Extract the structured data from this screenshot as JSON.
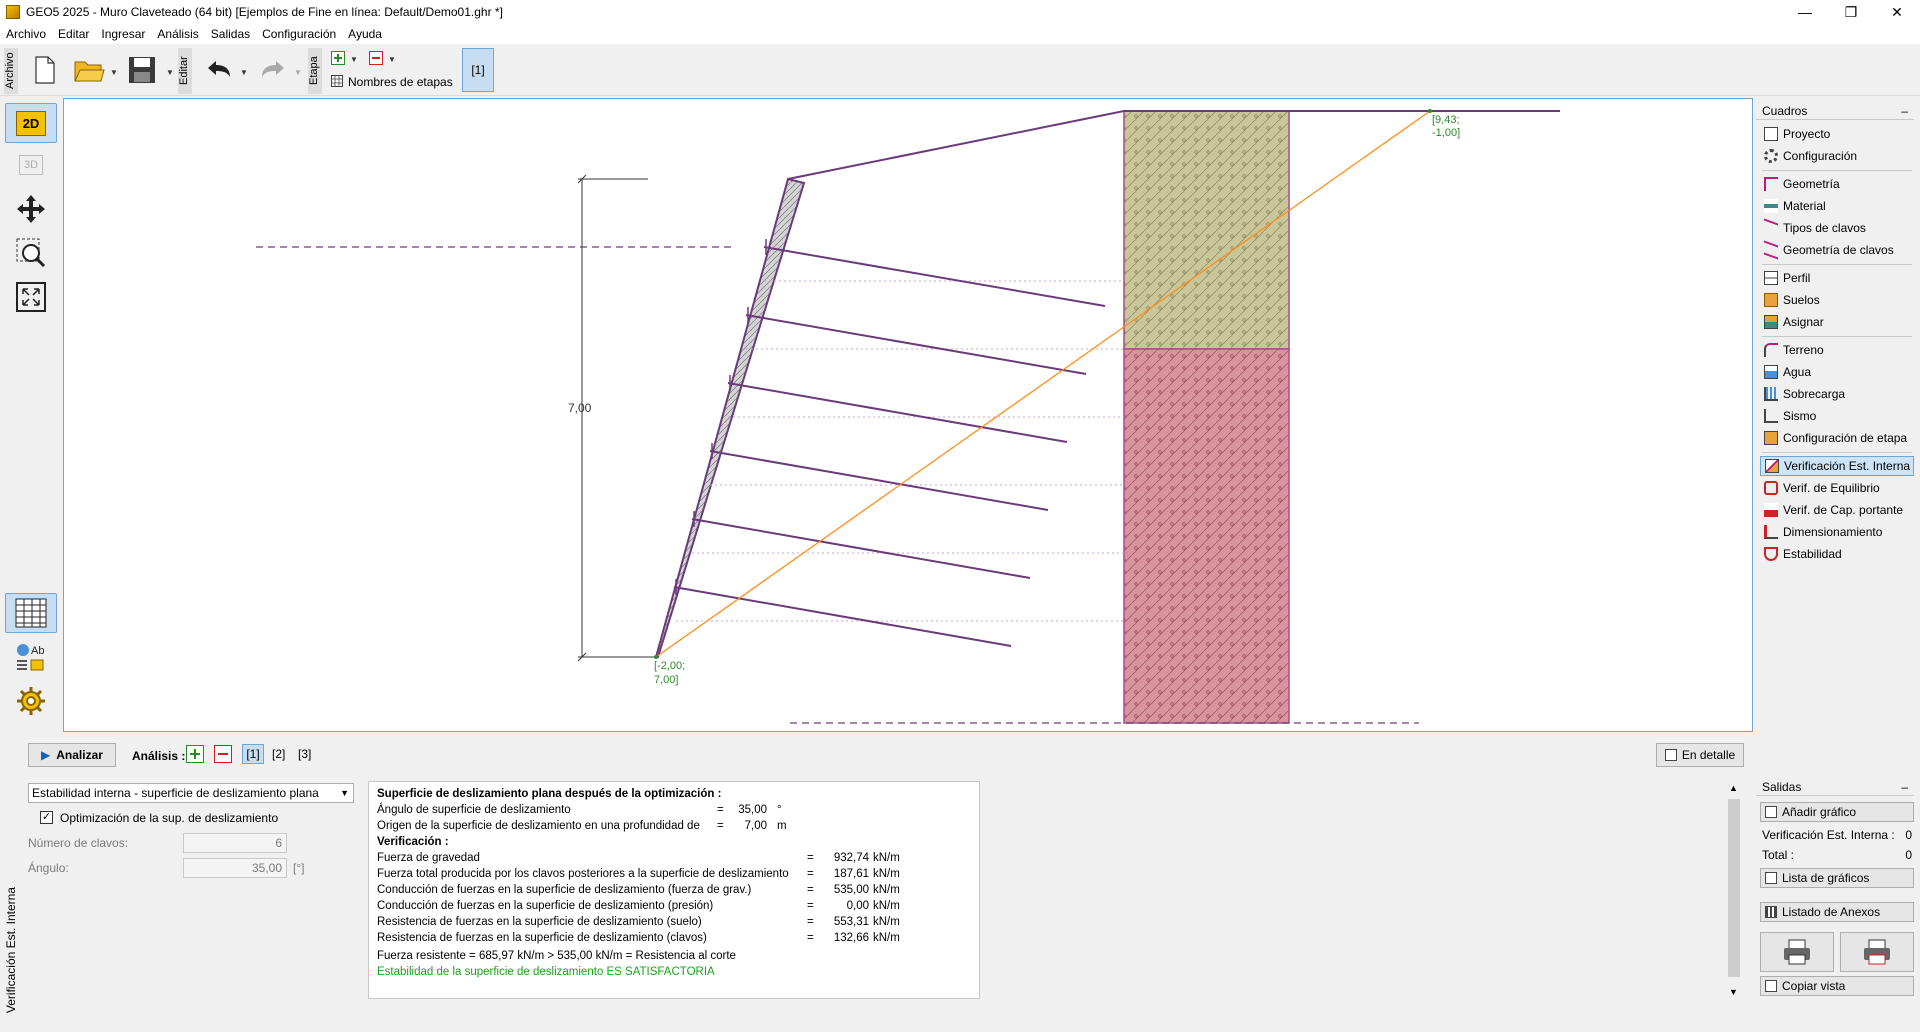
{
  "window": {
    "title": "GEO5 2025 - Muro Claveteado (64 bit) [Ejemplos de Fine en línea: Default/Demo01.ghr *]",
    "minimize": "—",
    "restore": "❐",
    "close": "✕"
  },
  "menu": [
    "Archivo",
    "Editar",
    "Ingresar",
    "Análisis",
    "Salidas",
    "Configuración",
    "Ayuda"
  ],
  "toolbar": {
    "archivo_label": "Archivo",
    "editar_label": "Editar",
    "etapa_label": "Etapa",
    "stage_names_label": "Nombres de etapas",
    "stage_button": "[1]"
  },
  "left_tools": {
    "mode_2d": "2D",
    "mode_3d": "3D",
    "text_tool": "Ab"
  },
  "canvas": {
    "dimension_label": "7,00",
    "point_top_right": [
      "[9,43;",
      "-1,00]"
    ],
    "point_bottom_left": [
      "[-2,00;",
      "7,00]"
    ]
  },
  "right_panel": {
    "cuadros_title": "Cuadros",
    "collapse": "–",
    "items": [
      {
        "label": "Proyecto",
        "icon": "document-icon"
      },
      {
        "label": "Configuración",
        "icon": "gear-icon"
      },
      {
        "label": "Geometría",
        "icon": "geometry-icon"
      },
      {
        "label": "Material",
        "icon": "material-icon"
      },
      {
        "label": "Tipos de clavos",
        "icon": "nail-types-icon"
      },
      {
        "label": "Geometría de clavos",
        "icon": "nail-geometry-icon"
      },
      {
        "label": "Perfil",
        "icon": "profile-icon"
      },
      {
        "label": "Suelos",
        "icon": "soils-icon"
      },
      {
        "label": "Asignar",
        "icon": "assign-icon"
      },
      {
        "label": "Terreno",
        "icon": "terrain-icon"
      },
      {
        "label": "Agua",
        "icon": "water-icon"
      },
      {
        "label": "Sobrecarga",
        "icon": "surcharge-icon"
      },
      {
        "label": "Sismo",
        "icon": "earthquake-icon"
      },
      {
        "label": "Configuración de etapa",
        "icon": "stage-settings-icon"
      },
      {
        "label": "Verificación Est. Interna",
        "icon": "internal-stability-icon"
      },
      {
        "label": "Verif. de Equilibrio",
        "icon": "equilibrium-icon"
      },
      {
        "label": "Verif. de Cap. portante",
        "icon": "bearing-capacity-icon"
      },
      {
        "label": "Dimensionamiento",
        "icon": "dimensioning-icon"
      },
      {
        "label": "Estabilidad",
        "icon": "stability-icon"
      }
    ],
    "salidas_title": "Salidas",
    "add_graphic": "Añadir gráfico",
    "verif_label": "Verificación Est. Interna :",
    "verif_value": "0",
    "total_label": "Total :",
    "total_value": "0",
    "graphics_list": "Lista de gráficos",
    "annex_list": "Listado de Anexos",
    "copy_view": "Copiar vista"
  },
  "bottom": {
    "side_tab": "Verificación Est. Interna",
    "analyze": "Analizar",
    "analysis_label": "Análisis :",
    "analysis_tabs": [
      "[1]",
      "[2]",
      "[3]"
    ],
    "detail": "En detalle",
    "method_select": "Estabilidad interna - superficie de deslizamiento plana",
    "optimization_label": "Optimización de la sup. de deslizamiento",
    "nails_label": "Número de clavos:",
    "nails_value": "6",
    "angle_label": "Ángulo:",
    "angle_value": "35,00",
    "angle_unit": "[°]"
  },
  "results": {
    "heading": "Superficie de deslizamiento plana después de la optimización :",
    "angle": {
      "label": "Ángulo de superficie de deslizamiento",
      "eq": "=",
      "value": "35,00",
      "unit": "°"
    },
    "origin": {
      "label": "Origen de la superficie de deslizamiento en una profundidad de",
      "eq": "=",
      "value": "7,00",
      "unit": "m"
    },
    "verif_heading": "Verificación :",
    "rows": [
      {
        "label": "Fuerza de gravedad",
        "eq": "=",
        "value": "932,74",
        "unit": "kN/m"
      },
      {
        "label": "Fuerza total producida por los clavos posteriores a la superficie de deslizamiento",
        "eq": "=",
        "value": "187,61",
        "unit": "kN/m"
      },
      {
        "label": "Conducción de fuerzas en la superficie de deslizamiento (fuerza de grav.)",
        "eq": "=",
        "value": "535,00",
        "unit": "kN/m"
      },
      {
        "label": "Conducción de fuerzas en la superficie de deslizamiento (presión)",
        "eq": "=",
        "value": "0,00",
        "unit": "kN/m"
      },
      {
        "label": "Resistencia de fuerzas en la superficie de deslizamiento (suelo)",
        "eq": "=",
        "value": "553,31",
        "unit": "kN/m"
      },
      {
        "label": "Resistencia de fuerzas en la superficie de deslizamiento (clavos)",
        "eq": "=",
        "value": "132,66",
        "unit": "kN/m"
      }
    ],
    "summary": "Fuerza resistente = 685,97 kN/m > 535,00 kN/m = Resistencia al corte",
    "status": "Estabilidad de la superficie de deslizamiento ES SATISFACTORIA"
  },
  "colors": {
    "accent": "#6ea6d6",
    "wall": "#6b3a7a",
    "slip": "#ff8c1a",
    "soil_top": "#c9c79a",
    "soil_bottom": "#d8949e",
    "ok": "#1aa31a"
  }
}
